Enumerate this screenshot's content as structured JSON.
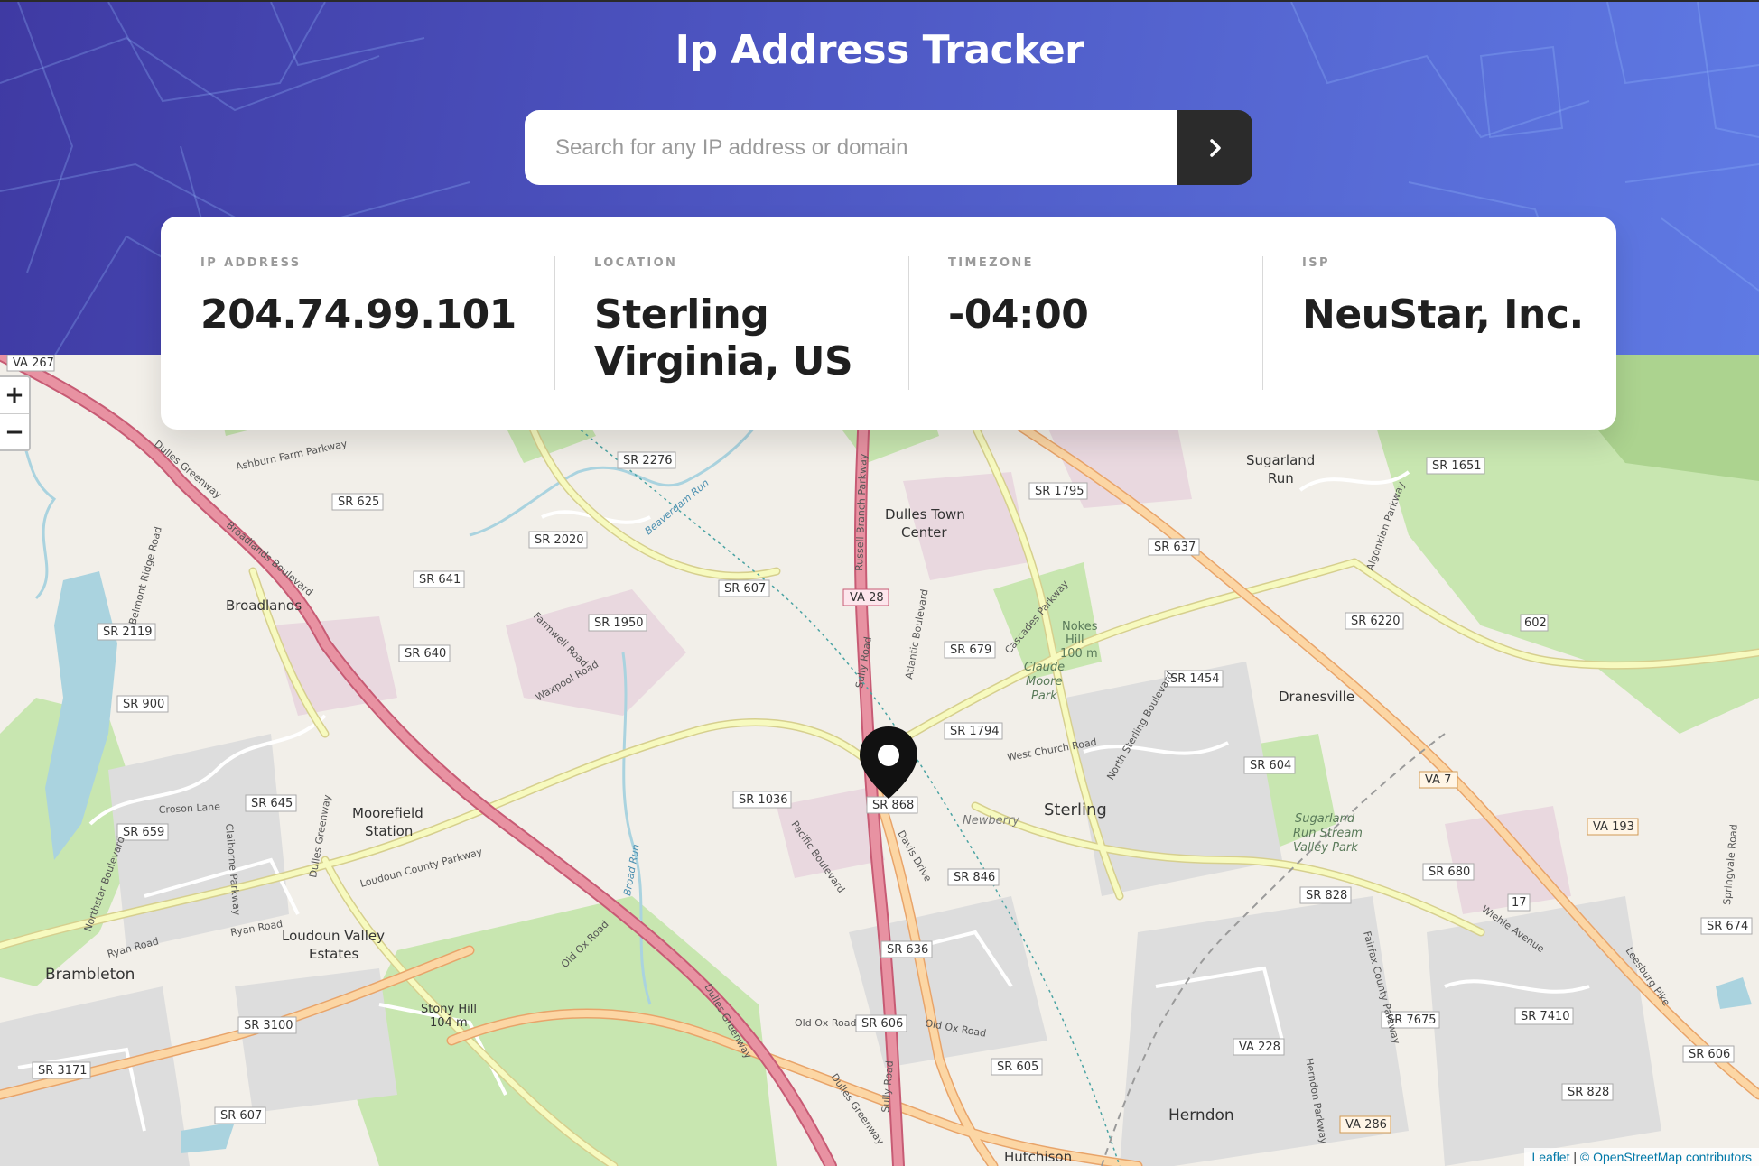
{
  "header": {
    "title": "Ip Address Tracker",
    "search": {
      "placeholder": "Search for any IP address or domain",
      "value": "",
      "button_icon": "chevron-right-icon"
    }
  },
  "info": {
    "ip": {
      "label": "IP Address",
      "value": "204.74.99.101"
    },
    "location": {
      "label": "Location",
      "value_line1": "Sterling",
      "value_line2": "Virginia, US"
    },
    "timezone": {
      "label": "Timezone",
      "value": "-04:00"
    },
    "isp": {
      "label": "ISP",
      "value": "NeuStar, Inc."
    }
  },
  "map": {
    "zoom_in": "+",
    "zoom_out": "−",
    "marker_icon": "map-pin-icon",
    "attribution_leaflet": "Leaflet",
    "attribution_osm": "© OpenStreetMap contributors",
    "places": [
      "Sugarland Run",
      "Dulles Town Center",
      "Broadlands",
      "Nokes Hill",
      "100 m",
      "Claude Moore Park",
      "Dranesville",
      "Sterling",
      "Newberry",
      "Moorefield Station",
      "Sugarland Run Stream Valley Park",
      "Loudoun Valley Estates",
      "Brambleton",
      "Stony Hill",
      "104 m",
      "Herndon",
      "Hutchison"
    ],
    "routes": [
      "VA 267",
      "SR 2276",
      "SR 1651",
      "SR 625",
      "SR 1795",
      "SR 2020",
      "SR 637",
      "SR 641",
      "SR 607",
      "VA 28",
      "SR 6220",
      "SR 1950",
      "SR 2119",
      "SR 640",
      "SR 679",
      "602",
      "SR 1454",
      "SR 900",
      "SR 1794",
      "SR 604",
      "VA 7",
      "SR 645",
      "SR 1036",
      "SR 868",
      "VA 193",
      "SR 659",
      "SR 680",
      "SR 846",
      "SR 828",
      "17",
      "SR 674",
      "SR 636",
      "SR 7675",
      "SR 7410",
      "SR 3100",
      "SR 606",
      "SR 605",
      "VA 228",
      "SR 3171",
      "SR 607",
      "SR 828",
      "VA 286",
      "SR 606"
    ],
    "roads": [
      "Dulles Greenway",
      "Ashburn Farm Parkway",
      "Broadlands Boulevard",
      "Belmont Ridge Road",
      "Farmwell Road",
      "Waxpool Road",
      "Russell Branch Parkway",
      "Sully Road",
      "Atlantic Boulevard",
      "Cascades Parkway",
      "West Church Road",
      "North Sterling Boulevard",
      "Loudoun County Parkway",
      "Croson Lane",
      "Claiborne Parkway",
      "Pacific Boulevard",
      "Davis Drive",
      "Northstar Boulevard",
      "Ryan Road",
      "Old Ox Road",
      "Fairfax County Parkway",
      "Wiehle Avenue",
      "Leesburg Pike",
      "Algonkian Parkway",
      "Herndon Parkway",
      "Springvale Road",
      "Broad Run",
      "Beaverdam Run"
    ]
  },
  "colors": {
    "header_start": "#3f3aa3",
    "header_end": "#5f7ae4",
    "button": "#2b2b2b",
    "major_road": "#e892a2",
    "trunk_road": "#fcd6a4",
    "secondary_road": "#f7fabf",
    "water": "#aad3df",
    "park": "#c8e6b0"
  }
}
